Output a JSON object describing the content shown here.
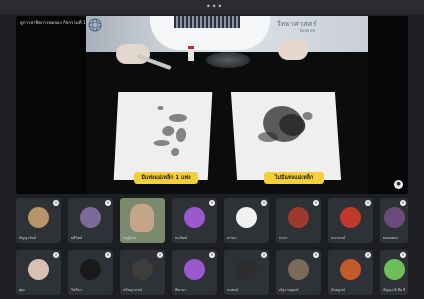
{
  "window": {
    "grip_glyph": "•••"
  },
  "presenter": {
    "name": "ดูการสาธิตการทดลอง กิจกรรมที่ 1"
  },
  "video": {
    "watermark": "วิทยาศาสตร์",
    "watermark_sub": "Science",
    "caption_left": "มีแท่งแม่เหล็ก 1 แท่ง",
    "caption_right": "ไม่มีแท่งแม่เหล็ก"
  },
  "controls": {
    "left_icon": "pin-icon",
    "right_icon": "fullscreen-icon"
  },
  "participants": [
    {
      "name": "กัญญารัตน์",
      "avatar_color": "#b8946a"
    },
    {
      "name": "ผลีนิตย์",
      "avatar_color": "#7b6a9a"
    },
    {
      "name": "ครูผู้สอน",
      "avatar_color": "#7b8a6c",
      "video": true
    },
    {
      "name": "ธนวัฒน์",
      "avatar_color": "#9b59d0"
    },
    {
      "name": "ธรรมะ",
      "avatar_color": "#f0f0f0"
    },
    {
      "name": "ธาดา",
      "avatar_color": "#9c3a30"
    },
    {
      "name": "ธนากรณ์",
      "avatar_color": "#c0392b"
    },
    {
      "name": "ผลอยทอง",
      "avatar_color": "#6a4b7a"
    },
    {
      "name": "พุฒ",
      "avatar_color": "#d8c1b4"
    },
    {
      "name": "รัชนีกร",
      "avatar_color": "#1a1a1a"
    },
    {
      "name": "ปรัชญาภรณ์",
      "avatar_color": "#3d3d3d"
    },
    {
      "name": "พิชามร",
      "avatar_color": "#9b59d0"
    },
    {
      "name": "ธนพงษ์",
      "avatar_color": "#2e2e2e"
    },
    {
      "name": "ณัฐภาณุพงษ์",
      "avatar_color": "#7a6a5a"
    },
    {
      "name": "ธันยบูรณ์",
      "avatar_color": "#c25a2a"
    },
    {
      "name": "กัญญาณี ฮีย สี",
      "avatar_color": "#6cbf5a"
    }
  ]
}
